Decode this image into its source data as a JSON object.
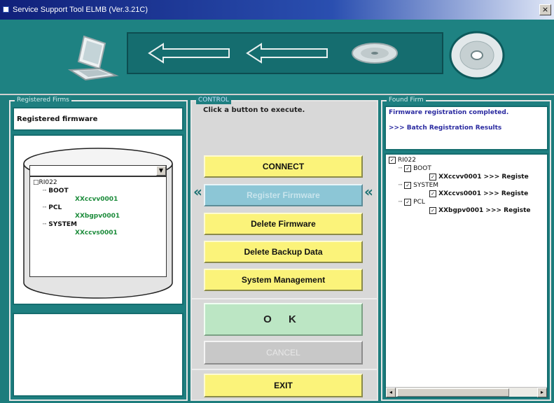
{
  "window": {
    "title": "Service Support Tool ELMB (Ver.3.21C)",
    "close_glyph": "×"
  },
  "banner": {
    "icons": [
      "laptop-icon",
      "arrow-left-icon",
      "arrow-left-icon",
      "disc-icon",
      "disc-icon"
    ]
  },
  "left_panel": {
    "label": "Registered Firms",
    "header": "Registered firmware",
    "dropdown_value": "",
    "dropdown_arrow": "▼",
    "tree": {
      "root": "RI022",
      "nodes": [
        {
          "name": "BOOT",
          "child": "XXccvv0001"
        },
        {
          "name": "PCL",
          "child": "XXbgpv0001"
        },
        {
          "name": "SYSTEM",
          "child": "XXccvs0001"
        }
      ]
    }
  },
  "control": {
    "label": "CONTROL",
    "instruction": "Click a button to execute.",
    "left_chevron": "«",
    "right_chevron": "«",
    "buttons": {
      "connect": "CONNECT",
      "register": "Register Firmware",
      "delete_firmware": "Delete Firmware",
      "delete_backup": "Delete Backup Data",
      "system_management": "System Management",
      "ok": "O K",
      "cancel": "CANCEL",
      "exit": "EXIT"
    }
  },
  "right_panel": {
    "label": "Found Firm",
    "status": "Firmware registration completed.",
    "results_link": ">>> Batch Registration Results",
    "tree": {
      "root": "RI022",
      "nodes": [
        {
          "name": "BOOT",
          "child": "XXccvv0001",
          "status": ">>> Registe"
        },
        {
          "name": "SYSTEM",
          "child": "XXccvs0001",
          "status": ">>> Registe"
        },
        {
          "name": "PCL",
          "child": "XXbgpv0001",
          "status": ">>> Registe"
        }
      ]
    },
    "scroll_left": "◂",
    "scroll_right": "▸"
  },
  "colors": {
    "teal": "#1e8282",
    "button_yellow": "#fbf37a",
    "ok_green": "#bce6c4"
  }
}
